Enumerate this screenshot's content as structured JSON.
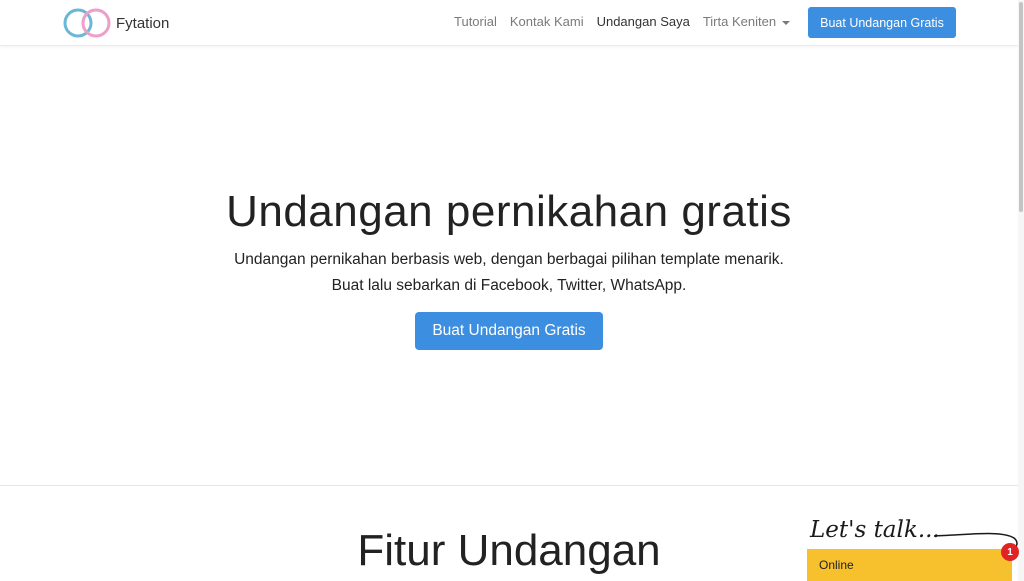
{
  "brand": {
    "name": "Fytation",
    "icon": "two-rings-logo-icon",
    "colors": {
      "ring_left": "#6ab7d6",
      "ring_right": "#ec9fc8"
    }
  },
  "nav": {
    "links": [
      {
        "label": "Tutorial"
      },
      {
        "label": "Kontak Kami"
      },
      {
        "label": "Undangan Saya"
      },
      {
        "label": "Tirta Keniten"
      }
    ],
    "cta_label": "Buat Undangan Gratis"
  },
  "hero": {
    "title": "Undangan pernikahan gratis",
    "desc_line1": "Undangan pernikahan berbasis web, dengan berbagai pilihan template menarik.",
    "desc_line2": "Buat lalu sebarkan di Facebook, Twitter, WhatsApp.",
    "cta_label": "Buat Undangan Gratis"
  },
  "features": {
    "title": "Fitur Undangan"
  },
  "chat": {
    "script_text": "Let's talk...",
    "status": "Online",
    "badge_count": "1"
  },
  "colors": {
    "accent": "#3b8ee0",
    "chat_bg": "#f7c12d",
    "badge": "#e02424"
  }
}
